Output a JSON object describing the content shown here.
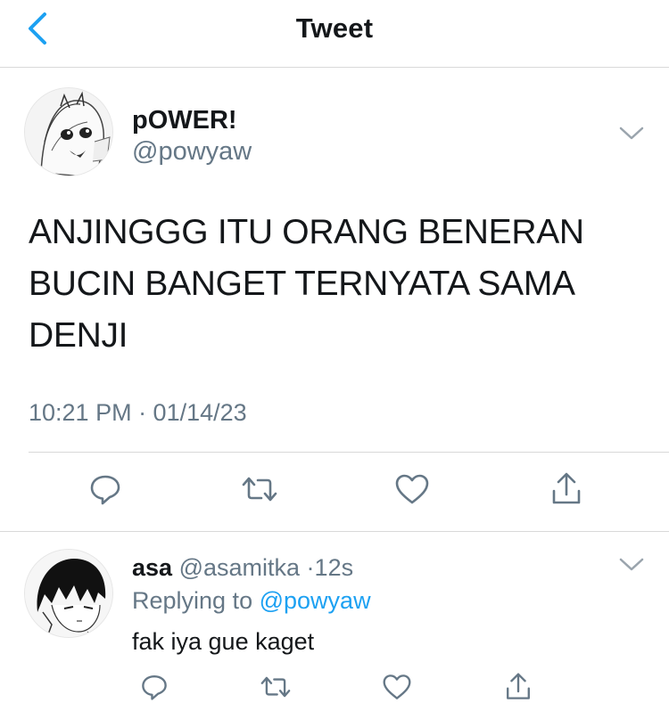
{
  "nav": {
    "title": "Tweet",
    "back_icon": "chevron-left-icon",
    "accent": "#1da1f2"
  },
  "tweet": {
    "display_name": "pOWER!",
    "handle": "@powyaw",
    "text": "ANJINGGG ITU ORANG BENERAN BUCIN BANGET TERNYATA SAMA DENJI",
    "timestamp": "10:21 PM · 01/14/23",
    "actions": [
      "reply-icon",
      "retweet-icon",
      "like-icon",
      "share-icon"
    ]
  },
  "reply": {
    "display_name": "asa",
    "handle": "@asamitka",
    "separator": "·",
    "time": "12s",
    "replying_prefix": "Replying to",
    "replying_to": "@powyaw",
    "text": "fak iya gue kaget"
  },
  "colors": {
    "text": "#14171a",
    "secondary": "#657786",
    "divider": "#d9d9d9",
    "link": "#1da1f2"
  }
}
